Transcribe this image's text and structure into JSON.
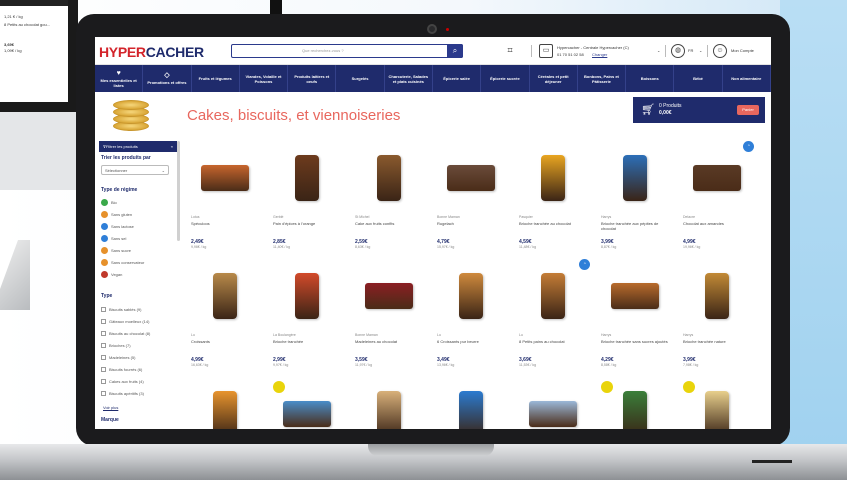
{
  "back_device": {
    "lines": [
      "1,21 € / kg",
      "8 Petits au chocolat gou...",
      "3,69€",
      "1,09€ / kg"
    ]
  },
  "site": {
    "logo_a": "HYPER",
    "logo_b": "CACHER",
    "search_placeholder": "Que recherchez-vous ?",
    "store_name": "Hypercacher - Centrale Hypercacher (C)",
    "store_phone": "01 70 51 02 58",
    "store_link": "Changer",
    "language": "FR",
    "account": "Mon Compte",
    "cart_count": "0 Produits",
    "cart_total": "0,00€",
    "cart_button": "Panier"
  },
  "nav": [
    {
      "icon": "♥",
      "label": "Mes essentielles et listes"
    },
    {
      "icon": "◇",
      "label": "Promotions et offres"
    },
    {
      "icon": "",
      "label": "Fruits et légumes"
    },
    {
      "icon": "",
      "label": "Viandes, Volaille et Poissons"
    },
    {
      "icon": "",
      "label": "Produits laitiers et oeufs"
    },
    {
      "icon": "",
      "label": "Surgelés"
    },
    {
      "icon": "",
      "label": "Charcuterie, Salades et plats cuisinés"
    },
    {
      "icon": "",
      "label": "Épicerie salée"
    },
    {
      "icon": "",
      "label": "Épicerie sucrée"
    },
    {
      "icon": "",
      "label": "Céréales et petit déjeuner"
    },
    {
      "icon": "",
      "label": "Bonbons, Pains et Pâtisserie"
    },
    {
      "icon": "",
      "label": "Boissons"
    },
    {
      "icon": "",
      "label": "Bébé"
    },
    {
      "icon": "",
      "label": "Non alimentaire"
    }
  ],
  "page": {
    "title": "Cakes, biscuits, et viennoiseries"
  },
  "sidebar": {
    "filter_header": "Filtrer les produits",
    "sort_label": "Trier les produits par",
    "sort_value": "Sélectionner",
    "regime_label": "Type de régime",
    "regimes": [
      {
        "label": "Bio",
        "color": "#3aa94a"
      },
      {
        "label": "Sans gluten",
        "color": "#e6912b"
      },
      {
        "label": "Sans lactose",
        "color": "#2f7fd8"
      },
      {
        "label": "Sans sel",
        "color": "#2f7fd8"
      },
      {
        "label": "Sans sucre",
        "color": "#e6912b"
      },
      {
        "label": "Sans conservateur",
        "color": "#e6912b"
      },
      {
        "label": "Vegan",
        "color": "#c0392b"
      }
    ],
    "type_label": "Type",
    "types": [
      "Biscuits sablés (9)",
      "Gâteaux moelleux (14)",
      "Biscuits au chocolat (8)",
      "Brioches (7)",
      "Madeleines (5)",
      "Biscuits fourrés (6)",
      "Cakes aux fruits (4)",
      "Biscuits apéritifs (3)"
    ],
    "more_link": "Voir plus",
    "trailing": "Marque"
  },
  "products": [
    {
      "brand": "Lotus",
      "name": "Spéculoos",
      "price": "2,49€",
      "unit": "9,96€ / kg",
      "color": "#c7652d",
      "badge": false,
      "promo": false
    },
    {
      "brand": "Gerblé",
      "name": "Pain d'épices à l'orange",
      "price": "2,85€",
      "unit": "11,40€ / kg",
      "color": "#6d3b1d",
      "badge": false,
      "promo": false
    },
    {
      "brand": "St Michel",
      "name": "Cake aux fruits confits",
      "price": "2,59€",
      "unit": "8,63€ / kg",
      "color": "#8a5a2e",
      "badge": false,
      "promo": false
    },
    {
      "brand": "Bonne Maman",
      "name": "Rugelach",
      "price": "4,79€",
      "unit": "15,97€ / kg",
      "color": "#6a4b3a",
      "badge": false,
      "promo": false
    },
    {
      "brand": "Pasquier",
      "name": "Brioche tranchée au chocolat",
      "price": "4,59€",
      "unit": "11,48€ / kg",
      "color": "#e9a521",
      "badge": false,
      "promo": false
    },
    {
      "brand": "Harrys",
      "name": "Brioche tranchée aux pépites de chocolat",
      "price": "3,99€",
      "unit": "8,87€ / kg",
      "color": "#2c6fb8",
      "badge": false,
      "promo": false
    },
    {
      "brand": "Delacre",
      "name": "Chocolat aux amandes",
      "price": "4,99€",
      "unit": "19,96€ / kg",
      "color": "#5a3a25",
      "badge": true,
      "promo": false
    },
    {
      "brand": "Lu",
      "name": "Croissants",
      "price": "4,99€",
      "unit": "16,63€ / kg",
      "color": "#b88a4a",
      "badge": false,
      "promo": false
    },
    {
      "brand": "La Boulangère",
      "name": "Brioche tranchée",
      "price": "2,99€",
      "unit": "9,97€ / kg",
      "color": "#d24a2a",
      "badge": false,
      "promo": false
    },
    {
      "brand": "Bonne Maman",
      "name": "Madeleines au chocolat",
      "price": "3,59€",
      "unit": "11,97€ / kg",
      "color": "#8b1e23",
      "badge": false,
      "promo": false
    },
    {
      "brand": "Lu",
      "name": "6 Croissants pur beurre",
      "price": "3,49€",
      "unit": "13,96€ / kg",
      "color": "#cf8a3d",
      "badge": false,
      "promo": false
    },
    {
      "brand": "Lu",
      "name": "8 Petits pains au chocolat",
      "price": "3,69€",
      "unit": "11,53€ / kg",
      "color": "#c47d36",
      "badge": true,
      "promo": false
    },
    {
      "brand": "Harrys",
      "name": "Brioche tranchée sans sucres ajoutés",
      "price": "4,29€",
      "unit": "8,58€ / kg",
      "color": "#b86b2c",
      "badge": false,
      "promo": false
    },
    {
      "brand": "Harrys",
      "name": "Brioche tranchée nature",
      "price": "3,99€",
      "unit": "7,98€ / kg",
      "color": "#c28a36",
      "badge": false,
      "promo": false
    },
    {
      "brand": "",
      "name": "",
      "price": "",
      "unit": "",
      "color": "#e8942e",
      "badge": false,
      "promo": false
    },
    {
      "brand": "",
      "name": "",
      "price": "",
      "unit": "",
      "color": "#4a8dc9",
      "badge": false,
      "promo": true
    },
    {
      "brand": "",
      "name": "",
      "price": "",
      "unit": "",
      "color": "#d8b07a",
      "badge": false,
      "promo": false
    },
    {
      "brand": "",
      "name": "",
      "price": "",
      "unit": "",
      "color": "#2b7bd0",
      "badge": false,
      "promo": false
    },
    {
      "brand": "",
      "name": "",
      "price": "",
      "unit": "",
      "color": "#9bb8d8",
      "badge": false,
      "promo": false
    },
    {
      "brand": "",
      "name": "",
      "price": "",
      "unit": "",
      "color": "#3a7f3a",
      "badge": false,
      "promo": true
    },
    {
      "brand": "",
      "name": "",
      "price": "",
      "unit": "",
      "color": "#e8cf8c",
      "badge": false,
      "promo": true
    }
  ]
}
